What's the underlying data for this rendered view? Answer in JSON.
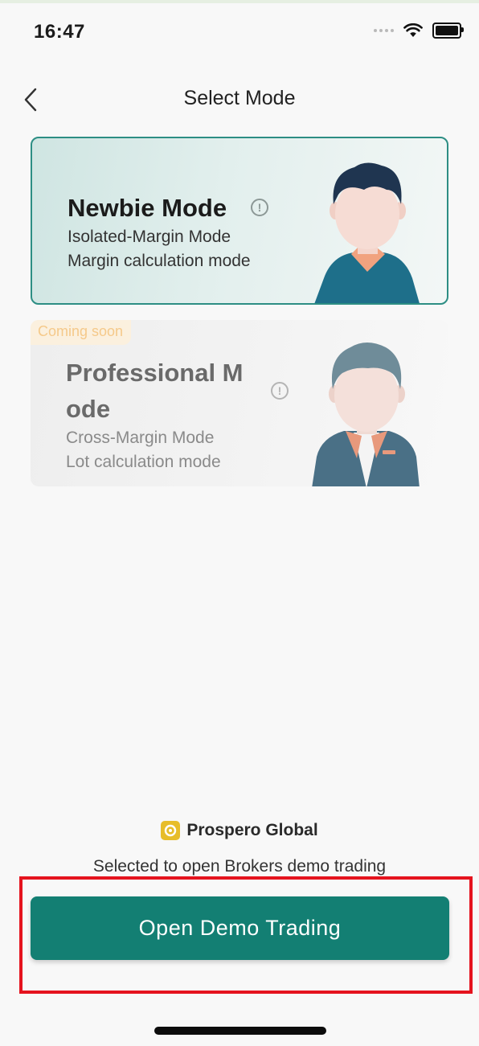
{
  "status_bar": {
    "time": "16:47"
  },
  "header": {
    "title": "Select Mode"
  },
  "modes": [
    {
      "title": "Newbie Mode",
      "line1": "Isolated-Margin Mode",
      "line2": "Margin calculation mode",
      "selected": true
    },
    {
      "badge": "Coming soon",
      "title_l1": "Professional M",
      "title_l2": "ode",
      "line1": "Cross-Margin Mode",
      "line2": "Lot calculation mode",
      "selected": false
    }
  ],
  "broker": {
    "name": "Prospero Global",
    "caption": "Selected to open Brokers demo trading"
  },
  "cta": {
    "label": "Open Demo Trading"
  },
  "colors": {
    "accent": "#137f73",
    "selected_border": "#2d8e84",
    "highlight_box": "#e5131e",
    "badge_text": "#f5c98a"
  }
}
